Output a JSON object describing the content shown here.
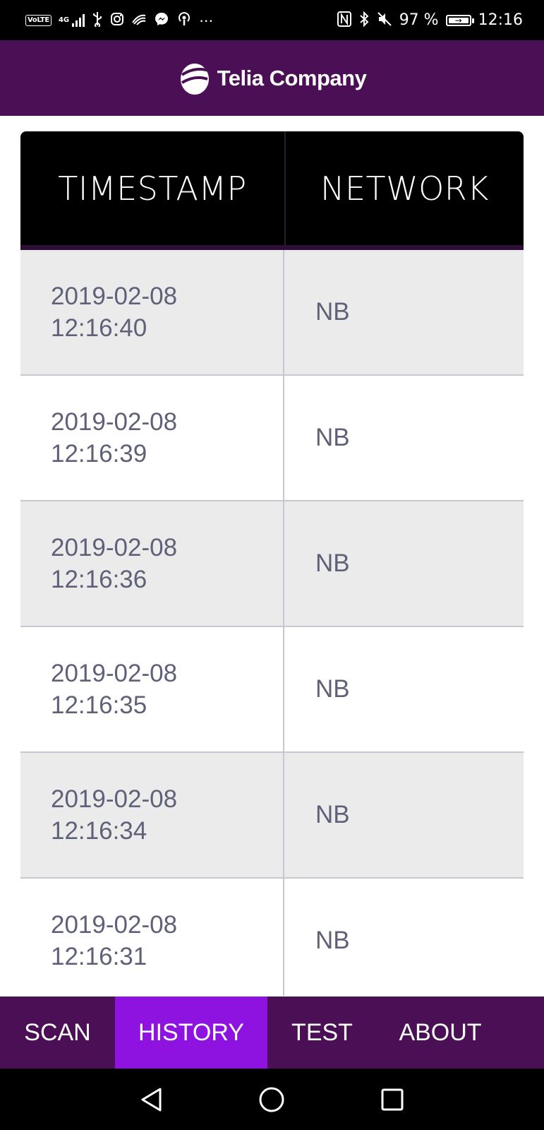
{
  "status_bar": {
    "volte": "VoLTE",
    "network_type": "4G",
    "battery_percent": "97 %",
    "time": "12:16",
    "icons": [
      "usb-icon",
      "instagram-icon",
      "swipe-icon",
      "messenger-icon",
      "podcast-icon",
      "more-icon",
      "nfc-icon",
      "bluetooth-icon",
      "mute-icon",
      "battery-icon"
    ]
  },
  "header": {
    "brand": "Telia Company",
    "background": "#4a0f54"
  },
  "table": {
    "columns": [
      "TIMESTAMP",
      "NETWORK"
    ],
    "rows": [
      {
        "date": "2019-02-08",
        "time": "12:16:40",
        "network": "NB"
      },
      {
        "date": "2019-02-08",
        "time": "12:16:39",
        "network": "NB"
      },
      {
        "date": "2019-02-08",
        "time": "12:16:36",
        "network": "NB"
      },
      {
        "date": "2019-02-08",
        "time": "12:16:35",
        "network": "NB"
      },
      {
        "date": "2019-02-08",
        "time": "12:16:34",
        "network": "NB"
      },
      {
        "date": "2019-02-08",
        "time": "12:16:31",
        "network": "NB"
      }
    ]
  },
  "tabs": {
    "items": [
      "SCAN",
      "HISTORY",
      "TEST",
      "ABOUT"
    ],
    "active": "HISTORY",
    "active_color": "#8e13e0"
  },
  "nav_bar": {
    "icons": [
      "back-icon",
      "home-icon",
      "recents-icon"
    ]
  }
}
